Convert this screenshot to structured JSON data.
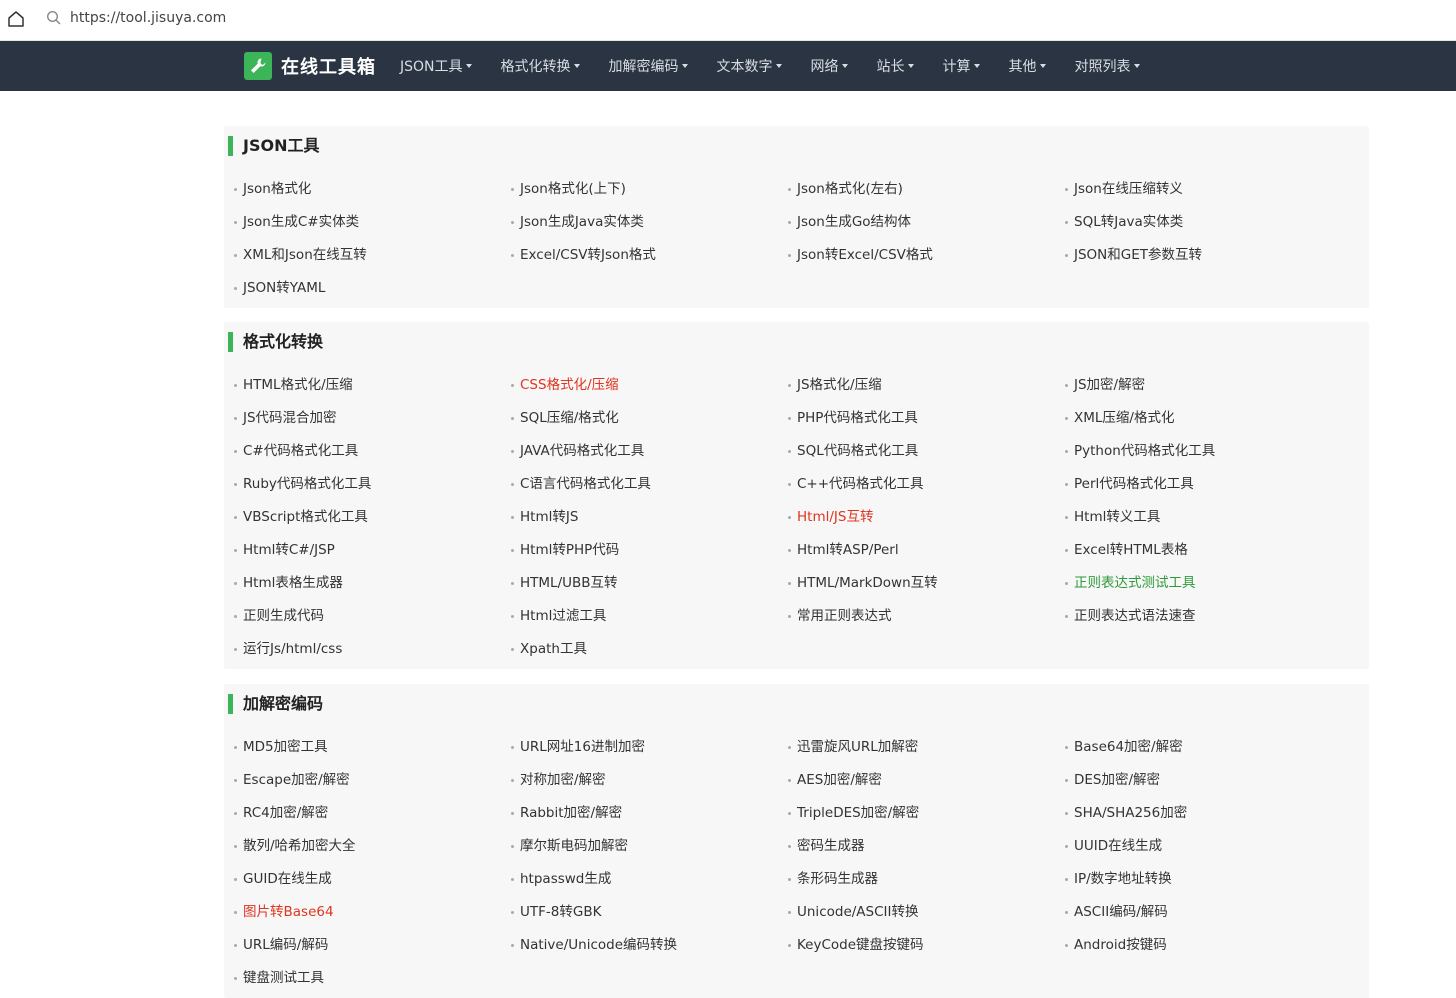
{
  "browser": {
    "url": "https://tool.jisuya.com"
  },
  "nav": {
    "brand": "在线工具箱",
    "menu": [
      "JSON工具",
      "格式化转换",
      "加解密编码",
      "文本数字",
      "网络",
      "站长",
      "计算",
      "其他",
      "对照列表"
    ]
  },
  "colors": {
    "nav_bg": "#2b3443",
    "accent": "#3cb558",
    "highlight_red": "#e0341f",
    "highlight_green": "#2e9a3a"
  },
  "sections": [
    {
      "title": "JSON工具",
      "items": [
        {
          "label": "Json格式化"
        },
        {
          "label": "Json格式化(上下)"
        },
        {
          "label": "Json格式化(左右)"
        },
        {
          "label": "Json在线压缩转义"
        },
        {
          "label": "Json生成C#实体类"
        },
        {
          "label": "Json生成Java实体类"
        },
        {
          "label": "Json生成Go结构体"
        },
        {
          "label": "SQL转Java实体类"
        },
        {
          "label": "XML和Json在线互转"
        },
        {
          "label": "Excel/CSV转Json格式"
        },
        {
          "label": "Json转Excel/CSV格式"
        },
        {
          "label": "JSON和GET参数互转"
        },
        {
          "label": "JSON转YAML"
        }
      ]
    },
    {
      "title": "格式化转换",
      "items": [
        {
          "label": "HTML格式化/压缩"
        },
        {
          "label": "CSS格式化/压缩",
          "style": "red"
        },
        {
          "label": "JS格式化/压缩"
        },
        {
          "label": "JS加密/解密"
        },
        {
          "label": "JS代码混合加密"
        },
        {
          "label": "SQL压缩/格式化"
        },
        {
          "label": "PHP代码格式化工具"
        },
        {
          "label": "XML压缩/格式化"
        },
        {
          "label": "C#代码格式化工具"
        },
        {
          "label": "JAVA代码格式化工具"
        },
        {
          "label": "SQL代码格式化工具"
        },
        {
          "label": "Python代码格式化工具"
        },
        {
          "label": "Ruby代码格式化工具"
        },
        {
          "label": "C语言代码格式化工具"
        },
        {
          "label": "C++代码格式化工具"
        },
        {
          "label": "Perl代码格式化工具"
        },
        {
          "label": "VBScript格式化工具"
        },
        {
          "label": "Html转JS"
        },
        {
          "label": "Html/JS互转",
          "style": "red"
        },
        {
          "label": "Html转义工具"
        },
        {
          "label": "Html转C#/JSP"
        },
        {
          "label": "Html转PHP代码"
        },
        {
          "label": "Html转ASP/Perl"
        },
        {
          "label": "Excel转HTML表格"
        },
        {
          "label": "Html表格生成器"
        },
        {
          "label": "HTML/UBB互转"
        },
        {
          "label": "HTML/MarkDown互转"
        },
        {
          "label": "正则表达式测试工具",
          "style": "green"
        },
        {
          "label": "正则生成代码"
        },
        {
          "label": "Html过滤工具"
        },
        {
          "label": "常用正则表达式"
        },
        {
          "label": "正则表达式语法速查"
        },
        {
          "label": "运行Js/html/css"
        },
        {
          "label": "Xpath工具"
        }
      ]
    },
    {
      "title": "加解密编码",
      "items": [
        {
          "label": "MD5加密工具"
        },
        {
          "label": "URL网址16进制加密"
        },
        {
          "label": "迅雷旋风URL加解密"
        },
        {
          "label": "Base64加密/解密"
        },
        {
          "label": "Escape加密/解密"
        },
        {
          "label": "对称加密/解密"
        },
        {
          "label": "AES加密/解密"
        },
        {
          "label": "DES加密/解密"
        },
        {
          "label": "RC4加密/解密"
        },
        {
          "label": "Rabbit加密/解密"
        },
        {
          "label": "TripleDES加密/解密"
        },
        {
          "label": "SHA/SHA256加密"
        },
        {
          "label": "散列/哈希加密大全"
        },
        {
          "label": "摩尔斯电码加解密"
        },
        {
          "label": "密码生成器"
        },
        {
          "label": "UUID在线生成"
        },
        {
          "label": "GUID在线生成"
        },
        {
          "label": "htpasswd生成"
        },
        {
          "label": "条形码生成器"
        },
        {
          "label": "IP/数字地址转换"
        },
        {
          "label": "图片转Base64",
          "style": "red"
        },
        {
          "label": "UTF-8转GBK"
        },
        {
          "label": "Unicode/ASCII转换"
        },
        {
          "label": "ASCII编码/解码"
        },
        {
          "label": "URL编码/解码"
        },
        {
          "label": "Native/Unicode编码转换"
        },
        {
          "label": "KeyCode键盘按键码"
        },
        {
          "label": "Android按键码"
        },
        {
          "label": "键盘测试工具"
        }
      ]
    }
  ]
}
